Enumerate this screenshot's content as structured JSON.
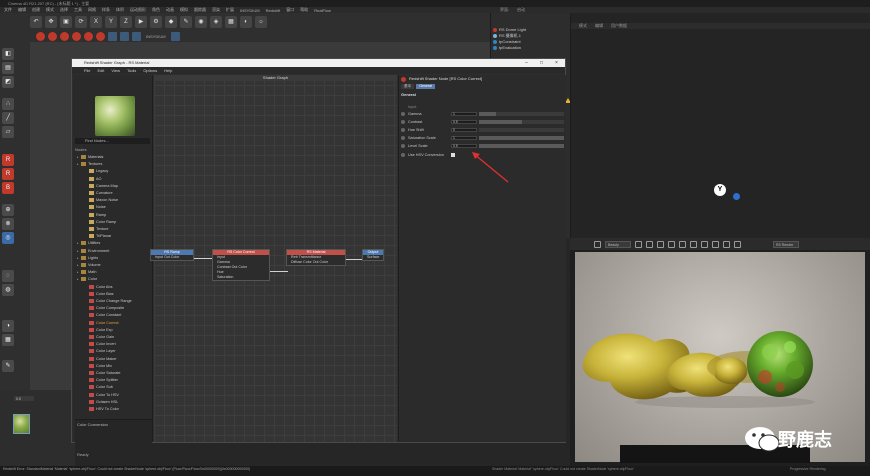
{
  "app": {
    "title_bar": "Cinema 4D R21.207 (RC) - [未标题 1 *] - 主要",
    "menu": [
      "文件",
      "编辑",
      "创建",
      "模式",
      "选择",
      "工具",
      "网格",
      "样条",
      "体积",
      "运动图形",
      "角色",
      "动画",
      "模拟",
      "跟踪器",
      "渲染",
      "扩展",
      "INSYDIUM",
      "Redshift",
      "窗口",
      "帮助",
      "RealFlow"
    ],
    "right_menu": [
      "界面:",
      "启动"
    ],
    "object_manager": {
      "items": [
        {
          "label": "RS Dome Light",
          "color": "#c0392b"
        },
        {
          "label": "RS 摄像机.1",
          "color": "#7fb3d5"
        },
        {
          "label": "tpConstraint",
          "color": "#2e86c1"
        },
        {
          "label": "tpEvaluation",
          "color": "#2e86c1"
        }
      ]
    },
    "attr_header": [
      "模式",
      "编辑",
      "用户数据"
    ],
    "status_left": "Redshift Error: StandardMaterial 'Material' 'sphere.obj/Floor': Could not create ShaderNode 'sphere.obj/Floor' (Floor/Floor/Floor/0x00000000)(0x000000000000)",
    "status_right": "Shader Material 'Material' 'sphere.obj/Floor' Could not create ShaderNode 'sphere.obj/Floor'",
    "status_rr": "Progressive Rendering",
    "mat_field": "0.0",
    "toolbar_labels": [
      "INSYDIUM",
      "tp"
    ]
  },
  "shader_graph": {
    "window_title": "Redshift Shader Graph - RS Material",
    "menu": [
      "File",
      "Edit",
      "View",
      "Tools",
      "Options",
      "Help"
    ],
    "find_nodes": "Find Nodes...",
    "nodes_header": "Nodes",
    "canvas_title": "Shader Graph",
    "tree": [
      {
        "label": "Materials",
        "indent": 0,
        "color": "#a8853c"
      },
      {
        "label": "Textures",
        "indent": 0,
        "color": "#a8853c"
      },
      {
        "label": "Legacy",
        "indent": 1,
        "color": "#c8a85a"
      },
      {
        "label": "AO",
        "indent": 1,
        "color": "#c8a85a"
      },
      {
        "label": "Camera Map",
        "indent": 1,
        "color": "#c8a85a"
      },
      {
        "label": "Curvature",
        "indent": 1,
        "color": "#c8a85a"
      },
      {
        "label": "Maxon Noise",
        "indent": 1,
        "color": "#c8a85a"
      },
      {
        "label": "Noise",
        "indent": 1,
        "color": "#c8a85a"
      },
      {
        "label": "Ramp",
        "indent": 1,
        "color": "#c8a85a"
      },
      {
        "label": "Color Ramp",
        "indent": 1,
        "color": "#c8a85a"
      },
      {
        "label": "Texture",
        "indent": 1,
        "color": "#c8a85a"
      },
      {
        "label": "TriPlanar",
        "indent": 1,
        "color": "#c8a85a"
      },
      {
        "label": "Utilities",
        "indent": 0,
        "color": "#a8853c"
      },
      {
        "label": "Environment",
        "indent": 0,
        "color": "#a8853c"
      },
      {
        "label": "Lights",
        "indent": 0,
        "color": "#a8853c"
      },
      {
        "label": "Volume",
        "indent": 0,
        "color": "#a8853c"
      },
      {
        "label": "Math",
        "indent": 0,
        "color": "#a8853c"
      },
      {
        "label": "Color",
        "indent": 0,
        "color": "#a8853c"
      },
      {
        "label": "Color Abs",
        "indent": 1,
        "color": "#c44a4a"
      },
      {
        "label": "Color Bias",
        "indent": 1,
        "color": "#c44a4a"
      },
      {
        "label": "Color Change Range",
        "indent": 1,
        "color": "#c44a4a"
      },
      {
        "label": "Color Composite",
        "indent": 1,
        "color": "#c44a4a"
      },
      {
        "label": "Color Constant",
        "indent": 1,
        "color": "#c44a4a"
      },
      {
        "label": "Color Correct",
        "indent": 1,
        "color": "#c44a4a",
        "highlight": true
      },
      {
        "label": "Color Exp",
        "indent": 1,
        "color": "#c44a4a"
      },
      {
        "label": "Color Gain",
        "indent": 1,
        "color": "#c44a4a"
      },
      {
        "label": "Color Invert",
        "indent": 1,
        "color": "#c44a4a"
      },
      {
        "label": "Color Layer",
        "indent": 1,
        "color": "#c44a4a"
      },
      {
        "label": "Color Maker",
        "indent": 1,
        "color": "#c44a4a"
      },
      {
        "label": "Color Mix",
        "indent": 1,
        "color": "#c44a4a"
      },
      {
        "label": "Color Saturate",
        "indent": 1,
        "color": "#c44a4a"
      },
      {
        "label": "Color Splitter",
        "indent": 1,
        "color": "#c44a4a"
      },
      {
        "label": "Color Sub",
        "indent": 1,
        "color": "#c44a4a"
      },
      {
        "label": "Color To HSV",
        "indent": 1,
        "color": "#c44a4a"
      },
      {
        "label": "Gclawm HSL",
        "indent": 1,
        "color": "#c44a4a"
      },
      {
        "label": "HSV To Color",
        "indent": 1,
        "color": "#c44a4a"
      }
    ],
    "color_conversion": "Color Conversion",
    "ready": "Ready",
    "graph_nodes": {
      "ramp": {
        "title": "RS Ramp",
        "rows": [
          "Input  Out Color"
        ]
      },
      "correct": {
        "title": "RS Color Correct",
        "rows": [
          "Input",
          "Gamma",
          "Contrast  Out Color",
          "Hue",
          "Saturation"
        ]
      },
      "material": {
        "title": "RS Material",
        "rows": [
          "Refr Transmittance",
          "Diffuse Color  Out Color"
        ]
      },
      "output": {
        "title": "Output",
        "rows": [
          "Surface"
        ]
      }
    },
    "properties": {
      "node_title": "Redshift Shader Node [RS Color Correct]",
      "tabs": [
        "基本",
        "General"
      ],
      "section": "General",
      "input_label": "Input",
      "rows": [
        {
          "label": "Gamma",
          "value": "1",
          "fill": 0.2
        },
        {
          "label": "Contrast",
          "value": "0.5",
          "fill": 0.5
        },
        {
          "label": "Hue Shift",
          "value": "0",
          "fill": 0.0
        },
        {
          "label": "Saturation Scale",
          "value": "1",
          "fill": 1.0
        },
        {
          "label": "Level Scale",
          "value": "0.5",
          "fill": 1.0
        }
      ],
      "checkbox": {
        "label": "Use HSV Conversion",
        "checked": true
      }
    }
  },
  "render_view": {
    "dropdown": "Beauty",
    "right_dropdown": "RS Render"
  },
  "watermark": "野鹿志"
}
